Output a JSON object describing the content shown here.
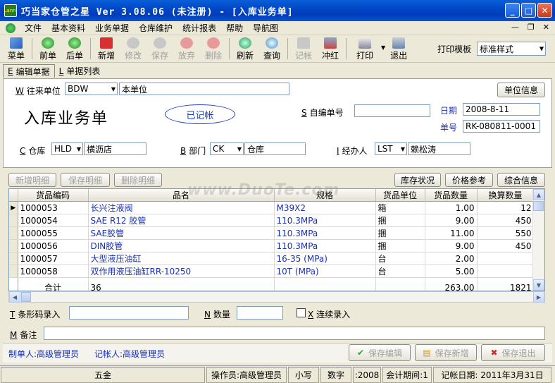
{
  "window": {
    "title": "巧当家仓管之星    Ver 3.08.06  (未注册) - [入库业务单]",
    "app_icon_text": "Lanni"
  },
  "menu": [
    "文件",
    "基本资料",
    "业务单据",
    "仓库维护",
    "统计报表",
    "帮助",
    "导航图"
  ],
  "toolbar": {
    "buttons": [
      {
        "label": "菜单",
        "icon": "menu-icon",
        "enabled": true
      },
      {
        "label": "前单",
        "icon": "prev-icon",
        "enabled": true
      },
      {
        "label": "后单",
        "icon": "next-icon",
        "enabled": true
      },
      {
        "label": "新增",
        "icon": "add-icon",
        "enabled": true
      },
      {
        "label": "修改",
        "icon": "edit-icon",
        "enabled": false
      },
      {
        "label": "保存",
        "icon": "save-icon",
        "enabled": false
      },
      {
        "label": "放弃",
        "icon": "cancel-icon",
        "enabled": false
      },
      {
        "label": "删除",
        "icon": "delete-icon",
        "enabled": false
      },
      {
        "label": "刷新",
        "icon": "refresh-icon",
        "enabled": true
      },
      {
        "label": "查询",
        "icon": "search-icon",
        "enabled": true
      },
      {
        "label": "记帐",
        "icon": "post-icon",
        "enabled": false
      },
      {
        "label": "冲红",
        "icon": "reverse-icon",
        "enabled": true
      },
      {
        "label": "打印",
        "icon": "print-icon",
        "enabled": true
      },
      {
        "label": "退出",
        "icon": "exit-icon",
        "enabled": true
      }
    ],
    "print_template_label": "打印模板",
    "print_template_value": "标准样式"
  },
  "tabs": [
    {
      "key": "E",
      "label": "编辑单据"
    },
    {
      "key": "L",
      "label": "单据列表"
    }
  ],
  "form": {
    "partner_key": "W",
    "partner_label": "往来单位",
    "partner_code": "BDW",
    "partner_name": "本单位",
    "unit_info_button": "单位信息",
    "doc_title": "入库业务单",
    "stamp": "已记帐",
    "self_no_key": "S",
    "self_no_label": "自编单号",
    "self_no_value": "",
    "date_label": "日期",
    "date_value": "2008-8-11",
    "doc_no_label": "单号",
    "doc_no_value": "RK-080811-0001",
    "warehouse_key": "C",
    "warehouse_label": "仓库",
    "warehouse_code": "HLD",
    "warehouse_name": "横沥店",
    "dept_key": "B",
    "dept_label": "部门",
    "dept_code": "CK",
    "dept_name": "仓库",
    "handler_key": "I",
    "handler_label": "经办人",
    "handler_code": "LST",
    "handler_name": "赖松涛"
  },
  "detail_buttons": {
    "add": "新增明细",
    "save": "保存明细",
    "delete": "删除明细",
    "stock": "库存状况",
    "price": "价格参考",
    "overall": "综合信息"
  },
  "watermark": "www.DuoTe.com",
  "grid": {
    "columns": [
      "货品编码",
      "品名",
      "规格",
      "货品单位",
      "货品数量",
      "换算数量"
    ],
    "rows": [
      {
        "code": "1000053",
        "name": "长兴注液阀",
        "spec": "M39X2",
        "unit": "箱",
        "qty": "1.00",
        "conv": "12"
      },
      {
        "code": "1000054",
        "name": "SAE R12 胶管",
        "spec": "110.3MPa",
        "unit": "捆",
        "qty": "9.00",
        "conv": "450"
      },
      {
        "code": "1000055",
        "name": "SAE胶管",
        "spec": "110.3MPa",
        "unit": "捆",
        "qty": "11.00",
        "conv": "550"
      },
      {
        "code": "1000056",
        "name": "DIN胶管",
        "spec": "110.3MPa",
        "unit": "捆",
        "qty": "9.00",
        "conv": "450"
      },
      {
        "code": "1000057",
        "name": "大型液压油缸",
        "spec": "16-35 (MPa)",
        "unit": "台",
        "qty": "2.00",
        "conv": ""
      },
      {
        "code": "1000058",
        "name": "双作用液压油缸RR-10250",
        "spec": "10T (MPa)",
        "unit": "台",
        "qty": "5.00",
        "conv": ""
      }
    ],
    "total_label": "合计",
    "total_count": "36",
    "total_qty": "263.00",
    "total_conv": "1821"
  },
  "entry": {
    "barcode_key": "T",
    "barcode_label": "条形码录入",
    "barcode_value": "",
    "qty_key": "N",
    "qty_label": "数量",
    "qty_value": "",
    "continuous_key": "X",
    "continuous_label": "连续录入",
    "remark_key": "M",
    "remark_label": "备注",
    "remark_value": ""
  },
  "footer": {
    "maker": "制单人:高级管理员",
    "poster": "记帐人:高级管理员",
    "save_edit": "保存编辑",
    "save_new": "保存新增",
    "save_exit": "保存退出"
  },
  "status": [
    "五金",
    "操作员:高级管理员",
    "小写",
    "数字",
    ":2008",
    "会计期间:1",
    "记帐日期: 2011年3月31日"
  ]
}
